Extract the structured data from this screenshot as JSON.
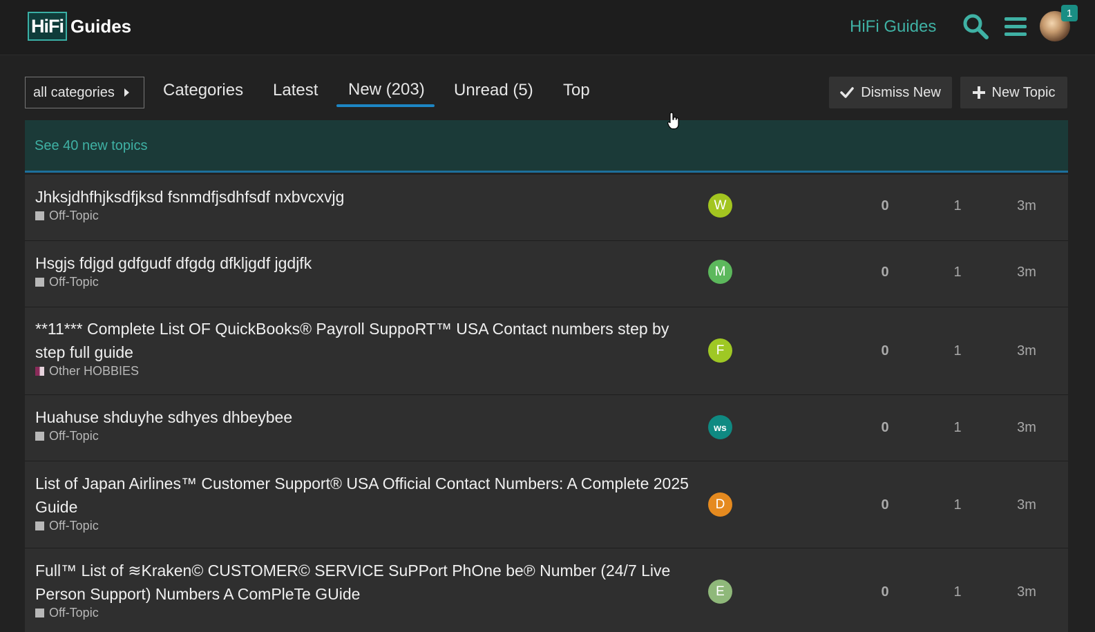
{
  "header": {
    "logo_box": "HiFi",
    "logo_text": "Guides",
    "site_link": "HiFi Guides",
    "notification_count": "1",
    "accent": "#3fb1a4"
  },
  "nav": {
    "category_dropdown": "all categories",
    "tabs": [
      {
        "label": "Categories"
      },
      {
        "label": "Latest"
      },
      {
        "label": "New (203)",
        "active": true
      },
      {
        "label": "Unread (5)"
      },
      {
        "label": "Top"
      }
    ],
    "dismiss_label": "Dismiss New",
    "new_topic_label": "New Topic"
  },
  "banner": {
    "text": "See 40 new topics"
  },
  "topics": [
    {
      "title": "Jhksjdhfhjksdfjksd fsnmdfjsdhfsdf nxbvcxvjg",
      "category": "Off-Topic",
      "poster_letter": "W",
      "poster_color": "#a3c520",
      "replies": "0",
      "views": "1",
      "activity": "3m"
    },
    {
      "title": "Hsgjs fdjgd gdfgudf dfgdg dfkljgdf jgdjfk",
      "category": "Off-Topic",
      "poster_letter": "M",
      "poster_color": "#5cb85c",
      "replies": "0",
      "views": "1",
      "activity": "3m"
    },
    {
      "title": "**11*** Complete List OF QuickBooks® Payroll SuppoRT™ USA Contact numbers step by step full guide",
      "category": "Other HOBBIES",
      "poster_letter": "F",
      "poster_color": "#9fc824",
      "replies": "0",
      "views": "1",
      "activity": "3m"
    },
    {
      "title": "Huahuse shduyhe sdhyes dhbeybee",
      "category": "Off-Topic",
      "poster_letter": "ws",
      "poster_color": "#0f8a82",
      "replies": "0",
      "views": "1",
      "activity": "3m"
    },
    {
      "title": "List of Japan Airlines™ Customer Support® USA Official Contact Numbers: A Complete 2025 Guide",
      "category": "Off-Topic",
      "poster_letter": "D",
      "poster_color": "#e58a1f",
      "replies": "0",
      "views": "1",
      "activity": "3m"
    },
    {
      "title": "Full™ List of ≋Kraken© CUSTOMER© SERVICE SuPPort PhOne be℗ Number (24/7 Live Person Support) Numbers A ComPleTe GUide",
      "category": "Off-Topic",
      "poster_letter": "E",
      "poster_color": "#8fb87a",
      "replies": "0",
      "views": "1",
      "activity": "3m"
    }
  ]
}
